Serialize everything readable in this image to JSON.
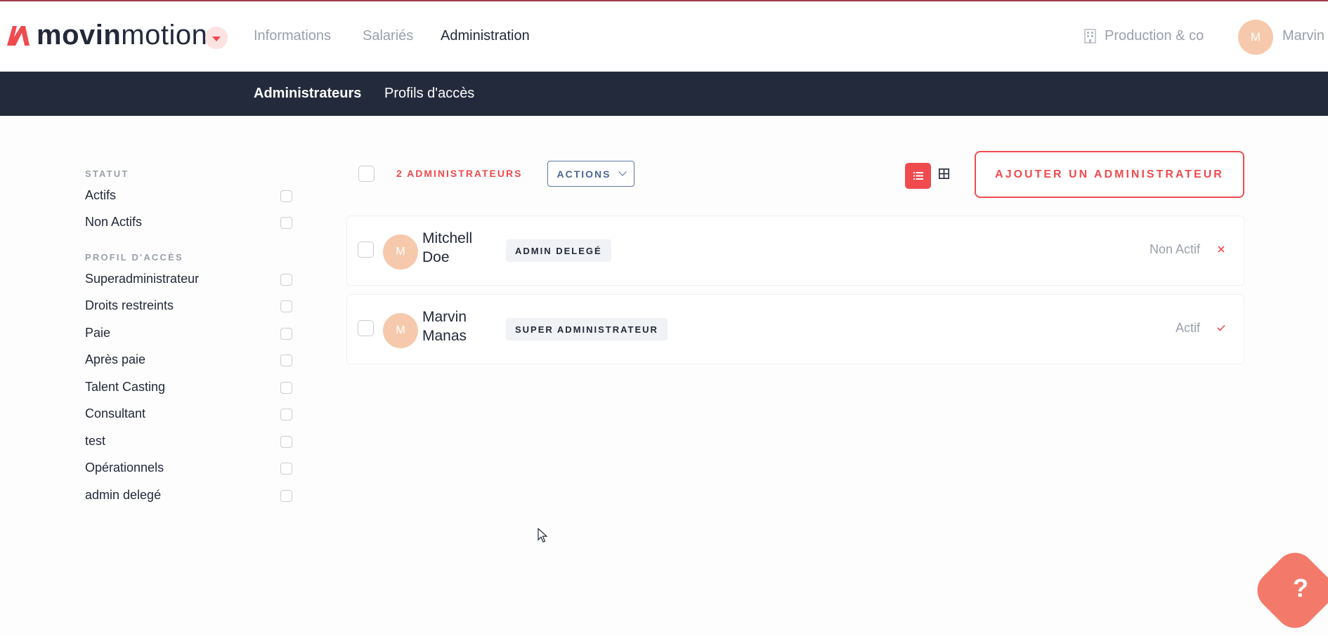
{
  "header": {
    "logo": {
      "bold": "movin",
      "light": "motion"
    },
    "nav": [
      "Informations",
      "Salariés",
      "Administration"
    ],
    "active_nav": "Administration",
    "company": "Production & co",
    "user": {
      "initial": "M",
      "name": "Marvin"
    }
  },
  "subnav": {
    "items": [
      "Administrateurs",
      "Profils d'accès"
    ],
    "active": "Administrateurs"
  },
  "filters": {
    "statut_title": "STATUT",
    "statut": [
      "Actifs",
      "Non Actifs"
    ],
    "profil_title": "PROFIL D'ACCÈS",
    "profils": [
      "Superadministrateur",
      "Droits restreints",
      "Paie",
      "Après paie",
      "Talent Casting",
      "Consultant",
      "test",
      "Opérationnels",
      "admin delegé"
    ]
  },
  "toolbar": {
    "count_label": "2 ADMINISTRATEURS",
    "actions_label": "ACTIONS",
    "add_label": "AJOUTER UN ADMINISTRATEUR",
    "view_mode": "list"
  },
  "admins": [
    {
      "initial": "M",
      "first": "Mitchell",
      "last": "Doe",
      "role": "ADMIN DELEGÉ",
      "status": "Non Actif",
      "status_icon": "x-icon"
    },
    {
      "initial": "M",
      "first": "Marvin",
      "last": "Manas",
      "role": "SUPER ADMINISTRATEUR",
      "status": "Actif",
      "status_icon": "check-icon"
    }
  ],
  "help": {
    "label": "?"
  },
  "colors": {
    "accent": "#ef4b4f",
    "navy": "#232a3b",
    "avatar": "#f6c9ac",
    "muted": "#9aa0ab"
  }
}
